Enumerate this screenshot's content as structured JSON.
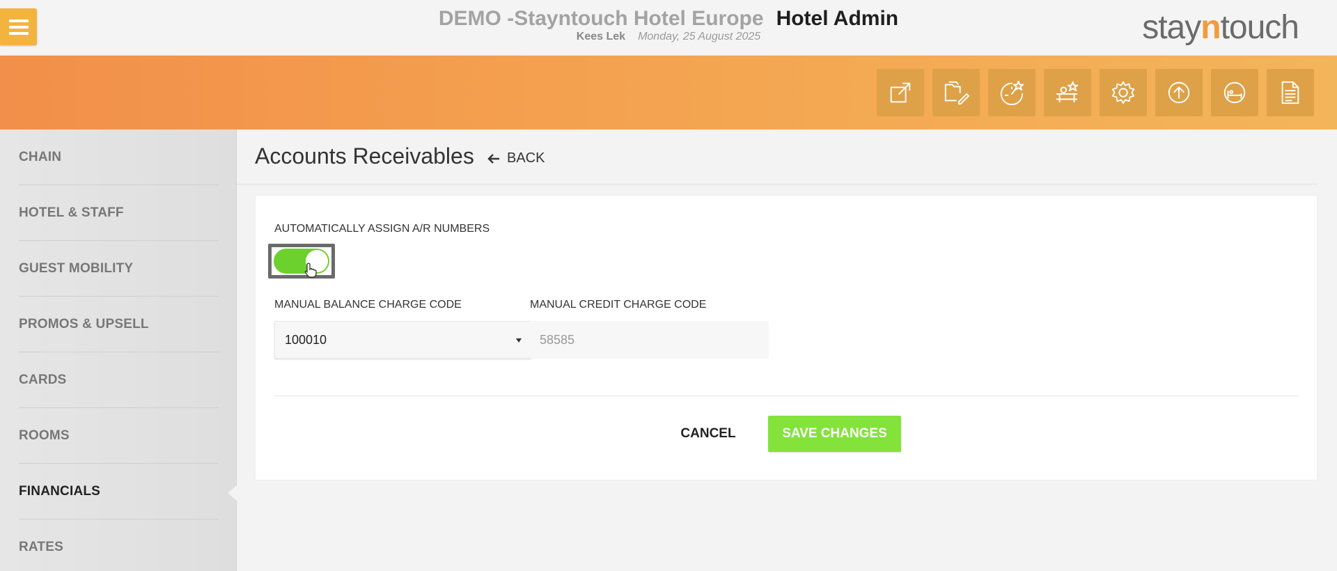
{
  "header": {
    "hotel_name": "DEMO -Stayntouch Hotel Europe",
    "app_name": "Hotel Admin",
    "user": "Kees Lek",
    "date": "Monday, 25 August 2025",
    "brand_prefix": "stay",
    "brand_n": "n",
    "brand_suffix": "touch",
    "menu_icon": "hamburger-icon"
  },
  "toolbar": {
    "icons": [
      "external-link-icon",
      "folder-edit-icon",
      "dashboard-star-icon",
      "housekeeping-star-icon",
      "gear-icon",
      "upload-icon",
      "bed-icon",
      "document-icon"
    ]
  },
  "sidebar": {
    "items": [
      {
        "label": "CHAIN"
      },
      {
        "label": "HOTEL & STAFF"
      },
      {
        "label": "GUEST MOBILITY"
      },
      {
        "label": "PROMOS & UPSELL"
      },
      {
        "label": "CARDS"
      },
      {
        "label": "ROOMS"
      },
      {
        "label": "FINANCIALS",
        "active": true
      },
      {
        "label": "RATES"
      }
    ]
  },
  "page": {
    "title": "Accounts Receivables",
    "back_label": "BACK"
  },
  "form": {
    "auto_assign_label": "AUTOMATICALLY ASSIGN A/R NUMBERS",
    "auto_assign_on": true,
    "balance_code_label": "MANUAL BALANCE CHARGE CODE",
    "balance_code_value": "100010",
    "credit_code_label": "MANUAL CREDIT CHARGE CODE",
    "credit_code_placeholder": "58585",
    "cancel_label": "CANCEL",
    "save_label": "SAVE CHANGES"
  },
  "colors": {
    "accent_orange": "#f4a450",
    "menu_yellow": "#f3b43f",
    "save_green": "#83e33a",
    "toggle_green": "#6cd12c"
  }
}
